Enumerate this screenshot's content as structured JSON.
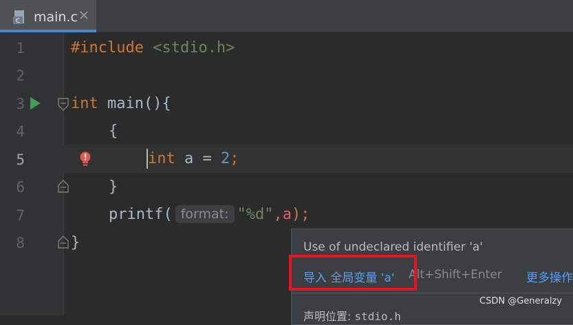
{
  "tab": {
    "file_name": "main.c",
    "close_label": "×"
  },
  "gutter": {
    "line_numbers": [
      "1",
      "2",
      "3",
      "4",
      "5",
      "6",
      "7",
      "8"
    ],
    "current_line": "5"
  },
  "code": {
    "line1": {
      "directive": "#include",
      "header": "<stdio.h>"
    },
    "line3": {
      "type": "int",
      "rest": " main(){"
    },
    "line4": {
      "text": "{"
    },
    "line5": {
      "type": "int",
      "name": " a = ",
      "value": "2",
      "semi": ";"
    },
    "line6": {
      "text": "}"
    },
    "line7": {
      "call": "printf(",
      "hint": "format:",
      "fmt": "\"%d\"",
      "comma": ",",
      "arg": "a",
      "close": ");"
    },
    "line8": {
      "text": "}"
    }
  },
  "popup": {
    "message": "Use of undeclared identifier 'a'",
    "action": "导入 全局变量 'a'",
    "shortcut": "Alt+Shift+Enter",
    "more": "更多操作",
    "declaration_label": "声明位置: ",
    "declaration_value": "stdio.h"
  },
  "watermark": "CSDN @Generalzy",
  "colors": {
    "editor_bg": "#2b2b2b",
    "keyword": "#cc7832",
    "string": "#6a8759",
    "number": "#6897bb",
    "link": "#589df6",
    "error": "#e06060",
    "highlight": "#e8141f"
  }
}
